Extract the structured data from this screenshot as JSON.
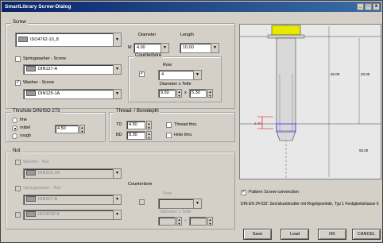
{
  "window": {
    "title": "SmartLibrary Screw-Dialog"
  },
  "screw": {
    "group_label": "Screw",
    "combo_value": "ISO4762-10_8",
    "diameter_label": "Diameter",
    "diameter_prefix": "M",
    "diameter_value": "4.00",
    "length_label": "Length",
    "length_value": "10.00",
    "springwasher_label": "Springwasher - Screw",
    "springwasher_value": "DIN127-A",
    "washer_label": "Washer - Screw",
    "washer_value": "DIN125-1A",
    "washer_checkmark": "✓"
  },
  "counterbore_top": {
    "label": "Counterbore",
    "row_label": "Row",
    "row_value": "4",
    "checkmark": "✓",
    "diameter_depth_label": "Diameter x Teife",
    "diameter_value": "9.50",
    "x_label": "x",
    "depth_value": "5.30"
  },
  "thread_hole": {
    "group_label": "Thruhole DIN/ISO 273",
    "fine_label": "fine",
    "middle_label": "mittel",
    "middle_value": "4.50",
    "rough_label": "rough"
  },
  "thread_depth": {
    "group_label": "Thread- / Boredepth",
    "td_label": "TD",
    "td_value": "4.50",
    "bd_label": "BD",
    "bd_value": "8.30",
    "thread_thru_label": "Thread thru",
    "hole_thru_label": "Hole thru"
  },
  "nut": {
    "group_label": "Nut",
    "washer_nut_label": "Washer - Nut",
    "washer_nut_value": "DIN125-1A",
    "springwasher_nut_label": "Springwasher - Nut",
    "springwasher_nut_value": "DIN127-A",
    "nut_value": "ISO4032-8",
    "counterbore_label": "Counterbore",
    "row_label": "Row",
    "diameter_depth_label": "Diameter x Teife",
    "x_label": "x"
  },
  "preview": {
    "dim_top": "20.00",
    "dim_mid": "30.00",
    "dim_small": "2.40",
    "dim_bottom": "50.00"
  },
  "pattern_label": "Pattern Screw-connection",
  "pattern_checkmark": "✓",
  "description": "DIN EN 24 032: Sechskantmutter mit Regelgewinde, Typ 1 Festigkeitsklasse 6",
  "buttons": {
    "save": "Save",
    "load": "Load",
    "ok": "OK",
    "cancel": "CANCEL"
  },
  "titlebar_buttons": {
    "minimize": "_",
    "maximize": "□",
    "close": "x"
  },
  "icons": [
    "chevron-down-icon",
    "spin-up-icon",
    "spin-down-icon",
    "check-icon"
  ]
}
